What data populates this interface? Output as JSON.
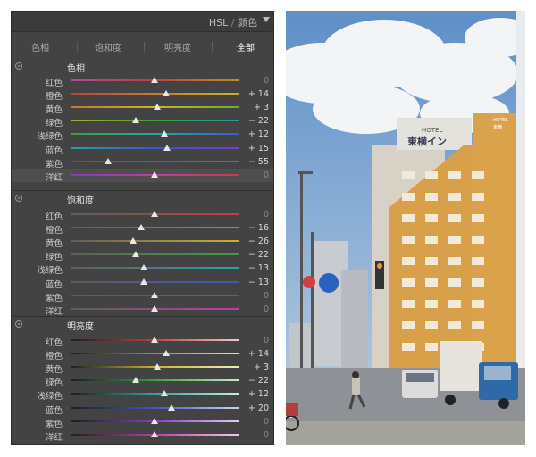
{
  "panel": {
    "title_en": "HSL",
    "title_sep": " / ",
    "title_cn": "颜色",
    "tabs": [
      {
        "label": "色相",
        "active": false
      },
      {
        "label": "饱和度",
        "active": false
      },
      {
        "label": "明亮度",
        "active": false
      },
      {
        "label": "全部",
        "active": true
      }
    ],
    "sections": [
      {
        "title": "色相",
        "rows": [
          {
            "label": "红色",
            "value": "0",
            "num": 0,
            "colors": [
              "#b04aa0",
              "#c0403c",
              "#c48a2a"
            ]
          },
          {
            "label": "橙色",
            "value": "+ 14",
            "num": 14,
            "colors": [
              "#b8443a",
              "#cc7a2e",
              "#c8b22e"
            ]
          },
          {
            "label": "黄色",
            "value": "+ 3",
            "num": 3,
            "colors": [
              "#c07a2c",
              "#c8b22e",
              "#6cae2e"
            ]
          },
          {
            "label": "绿色",
            "value": "− 22",
            "num": -22,
            "colors": [
              "#b0ae2c",
              "#3aa238",
              "#2e9aa2"
            ]
          },
          {
            "label": "浅绿色",
            "value": "+ 12",
            "num": 12,
            "colors": [
              "#3ca03a",
              "#2ea2a4",
              "#3a5ec4"
            ]
          },
          {
            "label": "蓝色",
            "value": "+ 15",
            "num": 15,
            "colors": [
              "#2e9ea8",
              "#3a58c6",
              "#7a3cc2"
            ]
          },
          {
            "label": "紫色",
            "value": "− 55",
            "num": -55,
            "colors": [
              "#3a56c4",
              "#8a3cc4",
              "#c43c9e"
            ]
          },
          {
            "label": "洋红",
            "value": "0",
            "num": 0,
            "colors": [
              "#7e3cc4",
              "#c03ca4",
              "#c43c4c"
            ]
          }
        ]
      },
      {
        "title": "饱和度",
        "rows": [
          {
            "label": "红色",
            "value": "0",
            "num": 0,
            "colors": [
              "#5e5e5e",
              "#c0403c"
            ]
          },
          {
            "label": "橙色",
            "value": "− 16",
            "num": -16,
            "colors": [
              "#5e5e5e",
              "#cc7a2e"
            ]
          },
          {
            "label": "黄色",
            "value": "− 26",
            "num": -26,
            "colors": [
              "#5e5e5e",
              "#c8b22e"
            ]
          },
          {
            "label": "绿色",
            "value": "− 22",
            "num": -22,
            "colors": [
              "#5e5e5e",
              "#3aa238"
            ]
          },
          {
            "label": "浅绿色",
            "value": "− 13",
            "num": -13,
            "colors": [
              "#5e5e5e",
              "#2ea2a4"
            ]
          },
          {
            "label": "蓝色",
            "value": "− 13",
            "num": -13,
            "colors": [
              "#5e5e5e",
              "#3a58c6"
            ]
          },
          {
            "label": "紫色",
            "value": "0",
            "num": 0,
            "colors": [
              "#5e5e5e",
              "#8a3cc4"
            ]
          },
          {
            "label": "洋红",
            "value": "0",
            "num": 0,
            "colors": [
              "#5e5e5e",
              "#c03ca4"
            ]
          }
        ]
      },
      {
        "title": "明亮度",
        "rows": [
          {
            "label": "红色",
            "value": "0",
            "num": 0,
            "colors": [
              "#1e1e1e",
              "#c0403c",
              "#f0c8c8"
            ]
          },
          {
            "label": "橙色",
            "value": "+ 14",
            "num": 14,
            "colors": [
              "#1e1e1e",
              "#cc7a2e",
              "#f2d6b8"
            ]
          },
          {
            "label": "黄色",
            "value": "+ 3",
            "num": 3,
            "colors": [
              "#1e1e1e",
              "#c8b22e",
              "#f0ecb8"
            ]
          },
          {
            "label": "绿色",
            "value": "− 22",
            "num": -22,
            "colors": [
              "#1e1e1e",
              "#3aa238",
              "#c6ecc4"
            ]
          },
          {
            "label": "浅绿色",
            "value": "+ 12",
            "num": 12,
            "colors": [
              "#1e1e1e",
              "#2ea2a4",
              "#c4ecec"
            ]
          },
          {
            "label": "蓝色",
            "value": "+ 20",
            "num": 20,
            "colors": [
              "#1e1e1e",
              "#3a58c6",
              "#c8d2f2"
            ]
          },
          {
            "label": "紫色",
            "value": "0",
            "num": 0,
            "colors": [
              "#1e1e1e",
              "#8a3cc4",
              "#e2c8f2"
            ]
          },
          {
            "label": "洋红",
            "value": "0",
            "num": 0,
            "colors": [
              "#1e1e1e",
              "#c03ca4",
              "#f2c8e8"
            ]
          }
        ]
      }
    ]
  },
  "photo": {
    "sign_top": "HOTEL",
    "sign_main": "東横イン",
    "side_sign_1": "HOTEL",
    "side_sign_2": "東横"
  }
}
